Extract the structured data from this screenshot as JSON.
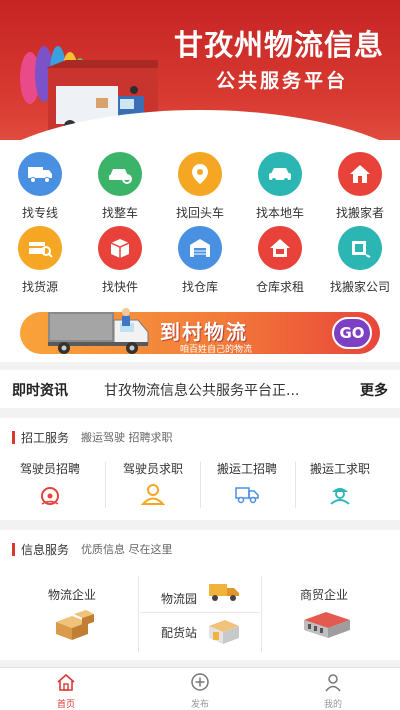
{
  "banner": {
    "title": "甘孜州物流信息",
    "subtitle": "公共服务平台"
  },
  "grid": [
    {
      "label": "找专线",
      "icon": "truck-icon",
      "color": "#4a90e2"
    },
    {
      "label": "找整车",
      "icon": "car-search-icon",
      "color": "#3bb46a"
    },
    {
      "label": "找回头车",
      "icon": "location-pin-icon",
      "color": "#f5a623"
    },
    {
      "label": "找本地车",
      "icon": "car-icon",
      "color": "#2bb5b3"
    },
    {
      "label": "找搬家者",
      "icon": "house-icon",
      "color": "#e8423a"
    },
    {
      "label": "找货源",
      "icon": "cargo-search-icon",
      "color": "#f5a623"
    },
    {
      "label": "找快件",
      "icon": "package-icon",
      "color": "#e8423a"
    },
    {
      "label": "找仓库",
      "icon": "warehouse-icon",
      "color": "#4a90e2"
    },
    {
      "label": "仓库求租",
      "icon": "home-rent-icon",
      "color": "#e8423a"
    },
    {
      "label": "找搬家公司",
      "icon": "moving-company-icon",
      "color": "#2bb5b3"
    }
  ],
  "promo": {
    "title": "到村物流",
    "subtitle": "咱百姓自己的物流",
    "go_label": "GO"
  },
  "news": {
    "title": "即时资讯",
    "text": "甘孜物流信息公共服务平台正...",
    "more": "更多"
  },
  "recruit": {
    "title": "招工服务",
    "hint": "搬运驾驶 招聘求职",
    "items": [
      {
        "label": "驾驶员招聘",
        "icon": "driver-hire-icon"
      },
      {
        "label": "驾驶员求职",
        "icon": "driver-job-icon"
      },
      {
        "label": "搬运工招聘",
        "icon": "porter-hire-icon"
      },
      {
        "label": "搬运工求职",
        "icon": "porter-job-icon"
      }
    ]
  },
  "info": {
    "title": "信息服务",
    "hint": "优质信息 尽在这里",
    "items": [
      {
        "label": "物流企业",
        "icon": "boxes-icon"
      },
      {
        "label": "物流园",
        "icon": "delivery-truck-icon"
      },
      {
        "label": "配货站",
        "icon": "distribution-station-icon"
      },
      {
        "label": "商贸企业",
        "icon": "trade-building-icon"
      }
    ]
  },
  "tabbar": [
    {
      "label": "首页",
      "icon": "home-icon",
      "active": true
    },
    {
      "label": "发布",
      "icon": "plus-circle-icon",
      "active": false
    },
    {
      "label": "我的",
      "icon": "user-icon",
      "active": false
    }
  ],
  "colors": {
    "brand": "#d83a31",
    "accent_purple": "#7d3fc4"
  }
}
